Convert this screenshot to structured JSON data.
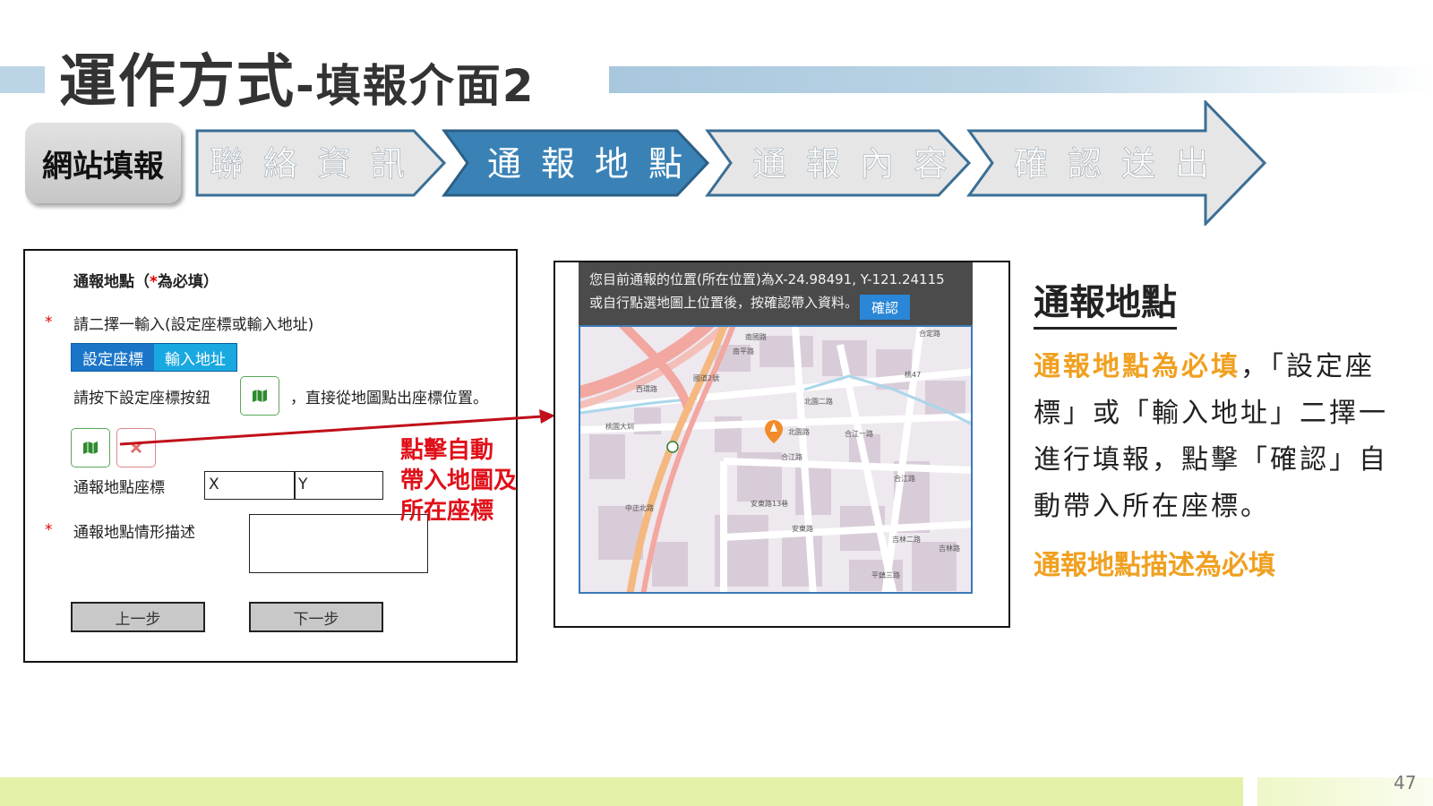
{
  "slide": {
    "title_main": "運作方式",
    "title_sub": "-填報介面2",
    "page_number": "47"
  },
  "flow": {
    "label": "網站填報",
    "steps": [
      "聯絡資訊",
      "通報地點",
      "通報內容",
      "確認送出"
    ],
    "active_index": 1,
    "colors": {
      "active": "#3a82b6",
      "inactive": "#e6e6e6",
      "border": "#3b6f96"
    }
  },
  "form": {
    "heading_prefix": "通報地點（",
    "heading_star": "*",
    "heading_suffix": "為必填）",
    "star": "*",
    "choose_label": "請二擇一輸入(設定座標或輸入地址)",
    "tab_coords": "設定座標",
    "tab_address": "輸入地址",
    "instruction_prefix": "請按下設定座標按鈕",
    "instruction_suffix": "，直接從地圖點出座標位置。",
    "coord_label": "通報地點座標",
    "x_value": "X",
    "y_value": "Y",
    "desc_label": "通報地點情形描述",
    "prev_button": "上一步",
    "next_button": "下一步",
    "annotation": "點擊自動帶入地圖及所在座標",
    "annotation_lines": [
      "點擊自動",
      "帶入地圖及",
      "所在座標"
    ]
  },
  "map": {
    "position_text": "您目前通報的位置(所在位置)為X-24.98491, Y-121.24115",
    "hint_text": "或自行點選地圖上位置後，按確認帶入資料。",
    "confirm_button": "確認",
    "labels": [
      "合定路",
      "南國路",
      "桃47",
      "北園二路",
      "合江一路",
      "合江路",
      "北園路",
      "合江路",
      "安東路",
      "吉林二路",
      "安東路13巷",
      "桃園大圳",
      "南平路",
      "中正北路",
      "吉林路",
      "平鎮三路",
      "國道2號",
      "西環路"
    ]
  },
  "right_panel": {
    "title": "通報地點",
    "highlight1": "通報地點為必填",
    "text1": "，「設定座標」或「輸入地址」二擇一進行填報，點擊「確認」自動帶入所在座標。",
    "highlight2": "通報地點描述為必填"
  }
}
